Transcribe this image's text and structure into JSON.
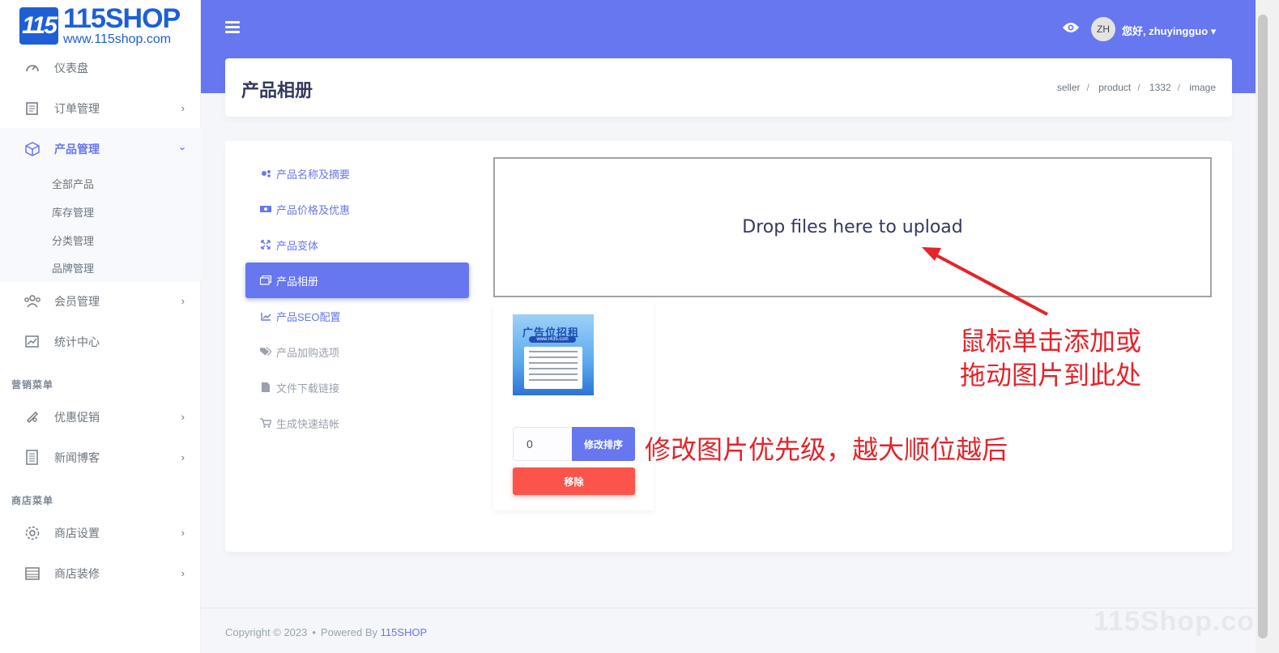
{
  "logo": {
    "name": "115SHOP",
    "url": "www.115shop.com",
    "mark": "115"
  },
  "sidebar": {
    "items": [
      {
        "label": "仪表盘"
      },
      {
        "label": "订单管理"
      },
      {
        "label": "产品管理"
      },
      {
        "label": "会员管理"
      },
      {
        "label": "统计中心"
      },
      {
        "label": "优惠促销"
      },
      {
        "label": "新闻博客"
      },
      {
        "label": "商店设置"
      },
      {
        "label": "商店装修"
      }
    ],
    "submenu": [
      "全部产品",
      "库存管理",
      "分类管理",
      "品牌管理"
    ],
    "headers": [
      "营销菜单",
      "商店菜单"
    ]
  },
  "topbar": {
    "avatar": "ZH",
    "greeting": "您好, zhuyingguo"
  },
  "header": {
    "title": "产品相册",
    "breadcrumb": [
      "seller",
      "product",
      "1332",
      "image"
    ]
  },
  "tabs": [
    {
      "label": "产品名称及摘要"
    },
    {
      "label": "产品价格及优惠"
    },
    {
      "label": "产品变体"
    },
    {
      "label": "产品相册"
    },
    {
      "label": "产品SEO配置"
    },
    {
      "label": "产品加购选项"
    },
    {
      "label": "文件下载链接"
    },
    {
      "label": "生成快速结帐"
    }
  ],
  "dropzone": {
    "text": "Drop files here to upload"
  },
  "image_card": {
    "thumb_title": "广告位招租",
    "thumb_url": "www.r435.com",
    "sort_value": "0",
    "sort_button": "修改排序",
    "remove_button": "移除"
  },
  "annotations": {
    "upload_line1": "鼠标单击添加或",
    "upload_line2": "拖动图片到此处",
    "sort": "修改图片优先级，越大顺位越后"
  },
  "footer": {
    "copyright": "Copyright © 2023",
    "powered": "Powered By",
    "brand": "115SHOP"
  },
  "watermark": "115Shop.com",
  "colors": {
    "primary": "#6777ef",
    "danger": "#fc544b",
    "annotation": "#e3242b"
  }
}
